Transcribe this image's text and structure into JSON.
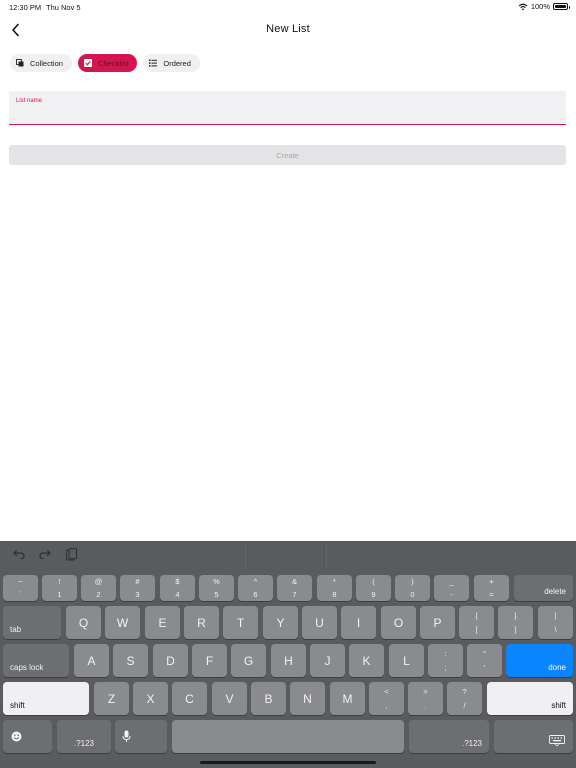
{
  "status": {
    "time": "12:30 PM",
    "date": "Thu Nov 5",
    "battery": "100%"
  },
  "header": {
    "title": "New List",
    "back_icon": "chevron-left-icon"
  },
  "chips": [
    {
      "label": "Collection",
      "icon": "collection-icon",
      "selected": false
    },
    {
      "label": "Checklist",
      "icon": "checkbox-icon",
      "selected": true
    },
    {
      "label": "Ordered",
      "icon": "ordered-list-icon",
      "selected": false
    }
  ],
  "form": {
    "field_label": "List name",
    "field_value": "",
    "create_label": "Create",
    "create_enabled": false
  },
  "colors": {
    "accent": "#d3164f",
    "done": "#0a84ff"
  },
  "keyboard": {
    "toolbar": [
      "undo-icon",
      "redo-icon",
      "paste-icon"
    ],
    "number_row": [
      {
        "top": "~",
        "bottom": "`"
      },
      {
        "top": "!",
        "bottom": "1"
      },
      {
        "top": "@",
        "bottom": "2"
      },
      {
        "top": "#",
        "bottom": "3"
      },
      {
        "top": "$",
        "bottom": "4"
      },
      {
        "top": "%",
        "bottom": "5"
      },
      {
        "top": "^",
        "bottom": "6"
      },
      {
        "top": "&",
        "bottom": "7"
      },
      {
        "top": "*",
        "bottom": "8"
      },
      {
        "top": "(",
        "bottom": "9"
      },
      {
        "top": ")",
        "bottom": "0"
      },
      {
        "top": "_",
        "bottom": "-"
      },
      {
        "top": "+",
        "bottom": "="
      }
    ],
    "delete": "delete",
    "tab": "tab",
    "row_q": [
      "Q",
      "W",
      "E",
      "R",
      "T",
      "Y",
      "U",
      "I",
      "O",
      "P"
    ],
    "row_q_extra": [
      {
        "top": "{",
        "bottom": "["
      },
      {
        "top": "}",
        "bottom": "]"
      },
      {
        "top": "|",
        "bottom": "\\"
      }
    ],
    "caps": "caps lock",
    "row_a": [
      "A",
      "S",
      "D",
      "F",
      "G",
      "H",
      "J",
      "K",
      "L"
    ],
    "row_a_extra": [
      {
        "top": ":",
        "bottom": ";"
      },
      {
        "top": "\"",
        "bottom": "'"
      }
    ],
    "done": "done",
    "shift": "shift",
    "row_z": [
      "Z",
      "X",
      "C",
      "V",
      "B",
      "N",
      "M"
    ],
    "row_z_extra": [
      {
        "top": "<",
        "bottom": ","
      },
      {
        "top": ">",
        "bottom": "."
      },
      {
        "top": "?",
        "bottom": "/"
      }
    ],
    "numbers": ".?123",
    "emoji_icon": "emoji-icon",
    "mic_icon": "microphone-icon",
    "hide_icon": "keyboard-hide-icon"
  }
}
